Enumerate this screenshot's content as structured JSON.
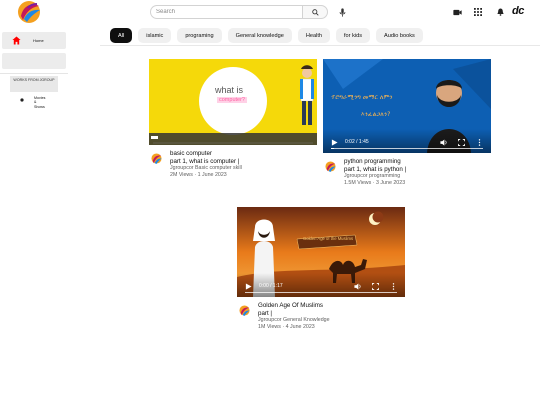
{
  "header": {
    "logo_name": "channel-logo",
    "search_placeholder": "Search",
    "search_icon": "search-icon",
    "mic_icon": "mic-icon",
    "create_icon": "video-camera-icon",
    "apps_icon": "grid-icon",
    "notifications_icon": "bell-icon",
    "account_text": "dc"
  },
  "sidebar": {
    "home_label": "Home",
    "works_text": "WORKS FROM JGROUP",
    "movies_label": "Movies & Shows"
  },
  "chips": [
    "All",
    "islamic",
    "programing",
    "General knowledge",
    "Health",
    "for kids",
    "Audio books"
  ],
  "videos": [
    {
      "title_line1": "basic computer",
      "title_line2": "part 1, what is computer |",
      "channel": "Jgroupcor Basic computer skill",
      "stats": "2M Views · 1 June 2023",
      "thumb_text": "what is",
      "thumb_text2": "computer?",
      "duration": "",
      "progress": 0.0
    },
    {
      "title_line1": "python programming",
      "title_line2": "part 1, what is python |",
      "channel": "Jgroupcor programming",
      "stats": "1.5M Views · 3 June 2023",
      "thumb_text": "ፕሮግራሚንግ መማር ለምን",
      "thumb_text2": "እንፈልጋለን?",
      "time": "0:02 / 1:45",
      "progress": 0.02
    },
    {
      "title_line1": "Golden Age Of Muslims",
      "title_line2": "part |",
      "channel": "Jgroupcor General Knowledge",
      "stats": "1M Views · 4 June 2023",
      "thumb_text": "Golden Age of the Muslims",
      "time": "0:00 / 1:17",
      "progress": 0.0
    }
  ],
  "colors": {
    "chip_active_bg": "#0f0f0f",
    "chip_bg": "#f0f0f0",
    "home_icon": "#ff0000",
    "thumb1_bg": "#f5d90a",
    "thumb2_bg": "#0d5fb3",
    "thumb3_bg": "#e8891f"
  }
}
